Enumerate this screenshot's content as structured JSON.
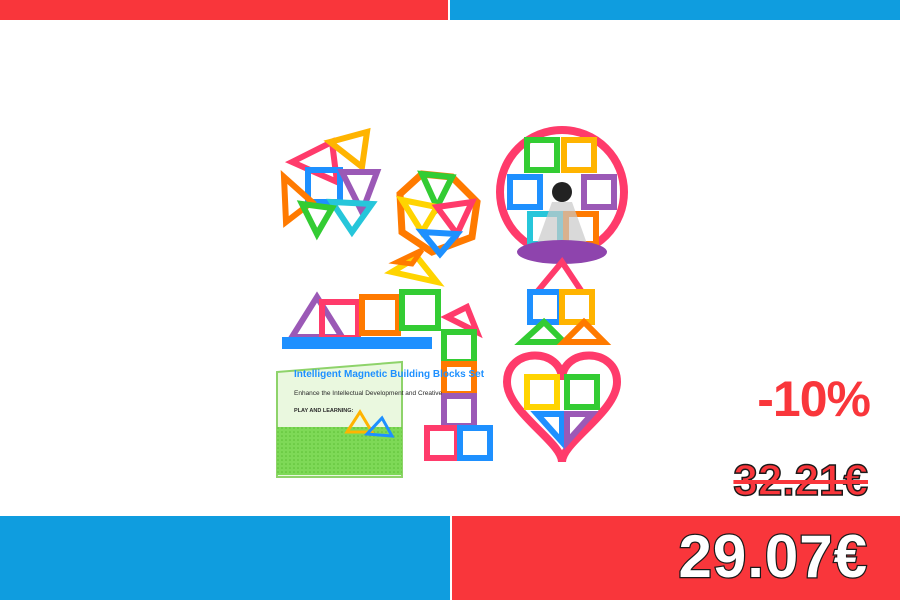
{
  "colors": {
    "accent_red": "#f9363b",
    "accent_blue": "#0f9ddf",
    "background": "#ffffff",
    "outline": "#1a1a1a",
    "price_fill": "#ffffff"
  },
  "product": {
    "image_icon": "magnetic-building-blocks-photo",
    "box_title": "Intelligent Magnetic Building Blocks Set",
    "box_subtitle": "Enhance the Intellectual Development and Creative",
    "box_heading": "PLAY AND LEARNING:"
  },
  "pricing": {
    "discount": "-10%",
    "old_price": "32.21€",
    "new_price": "29.07€"
  }
}
